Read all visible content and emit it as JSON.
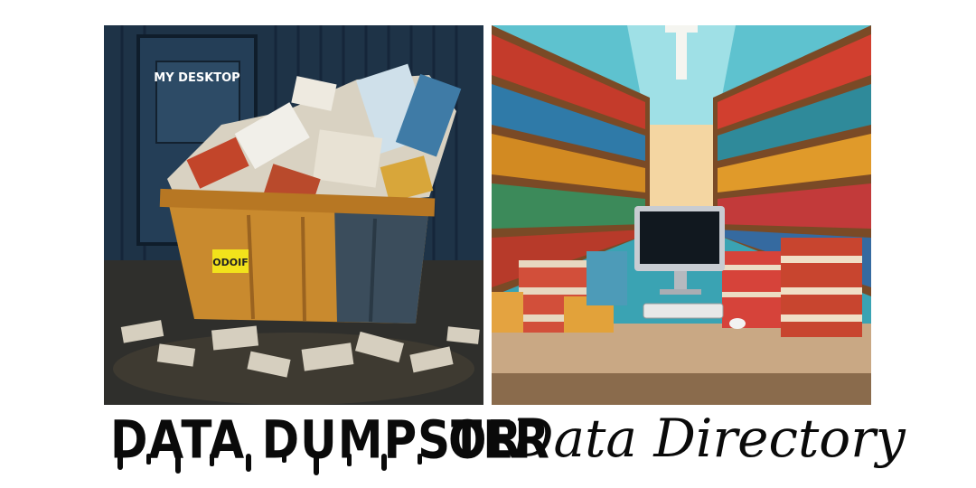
{
  "images": {
    "left": {
      "sign_text": "MY DESKTOP",
      "label_text": "ODOIF"
    },
    "right": {}
  },
  "caption": {
    "dumpster": "DATA DUMPSTER",
    "or": "OR",
    "directory": "Data Directory"
  },
  "colors": {
    "ink": "#0a0a0a",
    "dumpster_orange": "#c98a2e",
    "label_yellow": "#f2e21b"
  }
}
